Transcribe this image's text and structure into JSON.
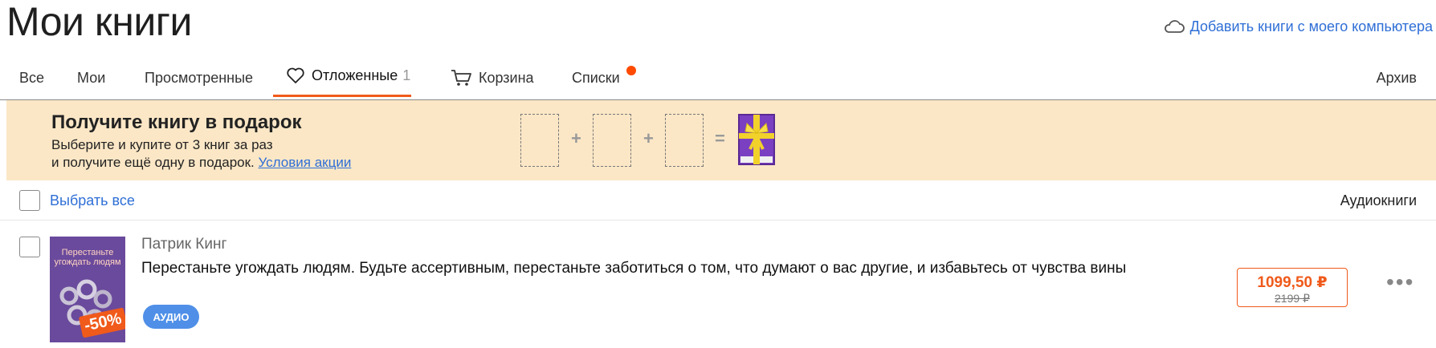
{
  "page": {
    "title": "Мои книги"
  },
  "header": {
    "add_books_label": "Добавить книги с моего компьютера",
    "add_books_icon": "cloud-icon"
  },
  "tabs": [
    {
      "label": "Все"
    },
    {
      "label": "Мои"
    },
    {
      "label": "Просмотренные"
    },
    {
      "label": "Отложенные",
      "count": "1",
      "icon": "heart-icon",
      "active": true
    },
    {
      "label": "Корзина",
      "icon": "cart-icon"
    },
    {
      "label": "Списки",
      "has_notification_dot": true
    },
    {
      "label": "Архив"
    }
  ],
  "promo": {
    "title": "Получите книгу в подарок",
    "line1": "Выберите и купите от 3 книг за раз",
    "line2": "и получите ещё одну в подарок.",
    "link": "Условия акции",
    "plus": "+",
    "equals": "=",
    "gift_icon": "gift-icon"
  },
  "selection": {
    "select_all": "Выбрать все",
    "audiobooks": "Аудиокниги"
  },
  "books": [
    {
      "author": "Патрик Кинг",
      "title": "Перестаньте угождать людям. Будьте ассертивным, перестаньте заботиться о том, что думают о вас другие, и избавьтесь от чувства вины",
      "badge": "АУДИО",
      "discount": "-50%",
      "price": "1099,50 ₽",
      "old_price": "2199 ₽",
      "more_icon": "more-icon",
      "cover": {
        "title": "Перестаньте угождать людям"
      }
    }
  ],
  "colors": {
    "accent": "#f05a1b",
    "link": "#2f6fd6",
    "promo_bg": "#fbe7c6",
    "badge": "#4f8fe8"
  }
}
